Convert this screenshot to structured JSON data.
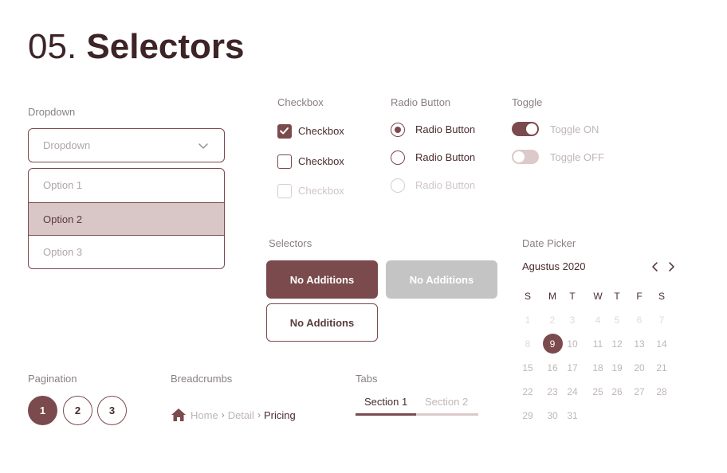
{
  "title": {
    "number": "05.",
    "word": "Selectors"
  },
  "dropdown": {
    "label": "Dropdown",
    "placeholder": "Dropdown",
    "options": [
      "Option 1",
      "Option 2",
      "Option 3"
    ],
    "selected_index": 1
  },
  "checkbox": {
    "label": "Checkbox",
    "items": [
      {
        "label": "Checkbox",
        "state": "checked"
      },
      {
        "label": "Checkbox",
        "state": "unchecked"
      },
      {
        "label": "Checkbox",
        "state": "disabled"
      }
    ]
  },
  "radio": {
    "label": "Radio Button",
    "items": [
      {
        "label": "Radio Button",
        "state": "checked"
      },
      {
        "label": "Radio Button",
        "state": "unchecked"
      },
      {
        "label": "Radio Button",
        "state": "disabled"
      }
    ]
  },
  "toggle": {
    "label": "Toggle",
    "items": [
      {
        "label": "Toggle ON",
        "state": "on"
      },
      {
        "label": "Toggle OFF",
        "state": "off"
      }
    ]
  },
  "selectors": {
    "label": "Selectors",
    "buttons": [
      {
        "label": "No Additions",
        "style": "filled"
      },
      {
        "label": "No Additions",
        "style": "disabled"
      },
      {
        "label": "No Additions",
        "style": "outline"
      }
    ]
  },
  "pagination": {
    "label": "Pagination",
    "pages": [
      "1",
      "2",
      "3"
    ],
    "active_page": "1"
  },
  "breadcrumbs": {
    "label": "Breadcrumbs",
    "icon": "home-icon",
    "items": [
      "Home",
      "Detail",
      "Pricing"
    ]
  },
  "tabs": {
    "label": "Tabs",
    "items": [
      "Section 1",
      "Section 2"
    ],
    "active_index": 0
  },
  "date_picker": {
    "label": "Date Picker",
    "month": "Agustus 2020",
    "weekdays": [
      "S",
      "M",
      "T",
      "W",
      "T",
      "F",
      "S"
    ],
    "weeks": [
      [
        "1",
        "2",
        "3",
        "4",
        "5",
        "6",
        "7"
      ],
      [
        "8",
        "9",
        "10",
        "11",
        "12",
        "13",
        "14"
      ],
      [
        "15",
        "16",
        "17",
        "18",
        "19",
        "20",
        "21"
      ],
      [
        "22",
        "23",
        "24",
        "25",
        "26",
        "27",
        "28"
      ],
      [
        "29",
        "30",
        "31"
      ]
    ],
    "selected_day": "9",
    "faded_days": [
      "1",
      "2",
      "3",
      "4",
      "5",
      "6",
      "7",
      "8"
    ]
  },
  "colors": {
    "accent": "#7b4a4d",
    "accent_light": "#d9c6c7",
    "text_dark": "#3d2426",
    "muted": "#c0b6b6",
    "disabled_button": "#c4c4c4"
  }
}
